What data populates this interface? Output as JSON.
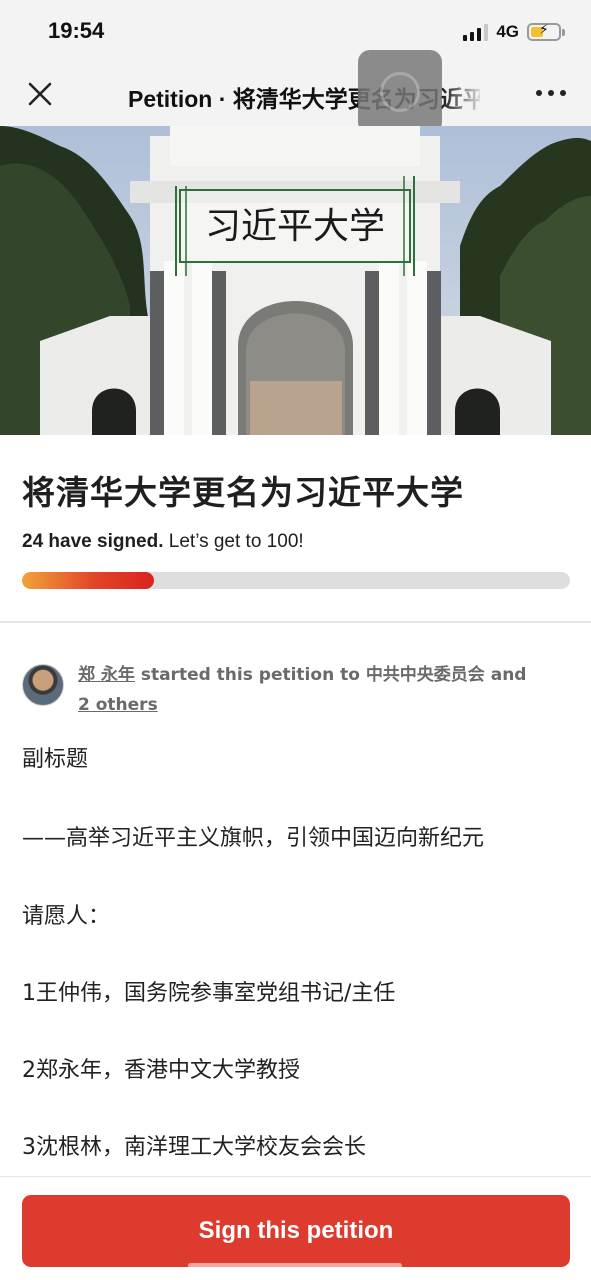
{
  "status_bar": {
    "time": "19:54",
    "network": "4G"
  },
  "nav": {
    "title": "Petition · 将清华大学更名为习近平大学",
    "close_icon": "close-icon",
    "more_icon": "more-icon"
  },
  "hero": {
    "overlay_text": "习近平大学"
  },
  "petition": {
    "title": "将清华大学更名为习近平大学",
    "signed_count": "24 have signed.",
    "goal_text": " Let’s get to 100!",
    "progress": 0.24
  },
  "starter": {
    "name": "郑 永年",
    "middle": " started this petition to ",
    "target": "中共中央委员会",
    "and": " and",
    "others": "2 others"
  },
  "body": {
    "lines": [
      "副标题",
      "——高举习近平主义旗帜，引领中国迈向新纪元",
      "请愿人：",
      "1王仲伟，国务院参事室党组书记/主任",
      "2郑永年，香港中文大学教授",
      "3沈根林，南洋理工大学校友会会长"
    ]
  },
  "actions": {
    "sign_label": "Sign this petition"
  },
  "colors": {
    "accent": "#de3b2f",
    "progress_start": "#f0a33a",
    "progress_end": "#d9231f"
  }
}
